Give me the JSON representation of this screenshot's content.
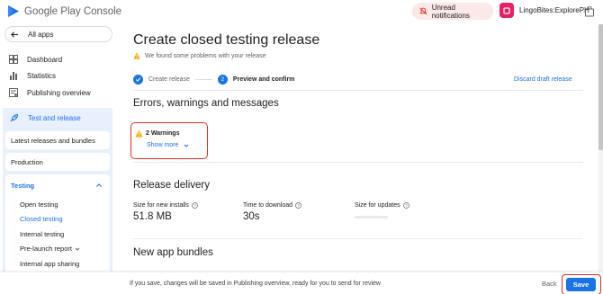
{
  "header": {
    "logo_text": "Google Play Console",
    "notifications_label": "Unread notifications",
    "app_name": "LingoBites:ExplorePH"
  },
  "sidebar": {
    "all_apps_label": "All apps",
    "items": [
      {
        "label": "Dashboard",
        "icon": "dashboard-icon"
      },
      {
        "label": "Statistics",
        "icon": "statistics-icon"
      },
      {
        "label": "Publishing overview",
        "icon": "publishing-icon"
      }
    ],
    "test_release": {
      "label": "Test and release",
      "sub_cards": [
        {
          "label": "Latest releases and bundles"
        },
        {
          "label": "Production"
        }
      ],
      "testing": {
        "label": "Testing",
        "items": [
          {
            "label": "Open testing"
          },
          {
            "label": "Closed testing"
          },
          {
            "label": "Internal testing"
          },
          {
            "label": "Pre-launch report"
          },
          {
            "label": "Internal app sharing"
          }
        ]
      }
    }
  },
  "main": {
    "title": "Create closed testing release",
    "warning_message": "We found some problems with your release",
    "steps": [
      {
        "number": "✓",
        "label": "Create release"
      },
      {
        "number": "2",
        "label": "Preview and confirm"
      }
    ],
    "discard_label": "Discard draft release",
    "errors_section_title": "Errors, warnings and messages",
    "warning_count": "2 Warnings",
    "show_more_label": "Show more",
    "delivery_section_title": "Release delivery",
    "metrics": [
      {
        "label": "Size for new installs",
        "value": "51.8 MB"
      },
      {
        "label": "Time to download",
        "value": "30s"
      },
      {
        "label": "Size for updates",
        "value": ""
      }
    ],
    "bundles_section_title": "New app bundles"
  },
  "footer": {
    "message": "If you save, changes will be saved in Publishing overview, ready for you to send for review",
    "back_label": "Back",
    "save_label": "Save"
  },
  "colors": {
    "accent": "#1a73e8",
    "warning": "#f9ab00",
    "highlight": "#d93025"
  }
}
